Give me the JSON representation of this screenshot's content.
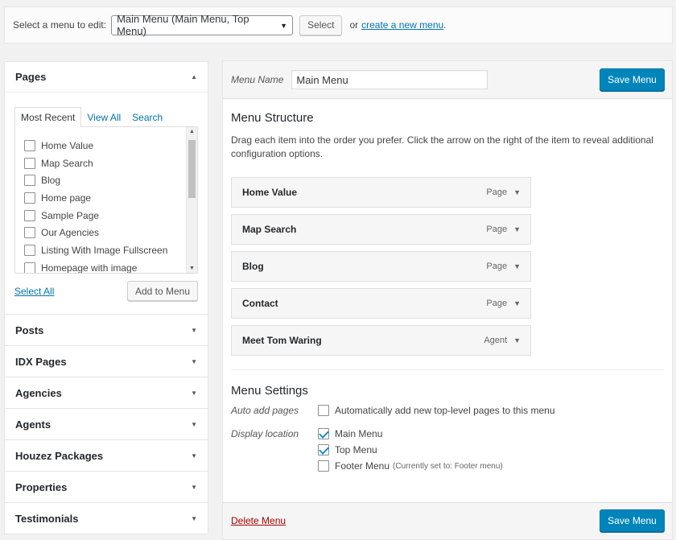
{
  "topbar": {
    "select_label": "Select a menu to edit:",
    "menu_select_value": "Main Menu (Main Menu, Top Menu)",
    "select_button": "Select",
    "or_text": "or",
    "create_link": "create a new menu",
    "period": "."
  },
  "sidebar": {
    "pages": {
      "title": "Pages",
      "tabs": [
        "Most Recent",
        "View All",
        "Search"
      ],
      "items": [
        "Home Value",
        "Map Search",
        "Blog",
        "Home page",
        "Sample Page",
        "Our Agencies",
        "Listing With Image Fullscreen",
        "Homepage with image"
      ],
      "select_all": "Select All",
      "add_button": "Add to Menu"
    },
    "sections": [
      "Posts",
      "IDX Pages",
      "Agencies",
      "Agents",
      "Houzez Packages",
      "Properties",
      "Testimonials"
    ]
  },
  "main": {
    "name_label": "Menu Name",
    "name_value": "Main Menu",
    "save_label": "Save Menu",
    "structure_title": "Menu Structure",
    "structure_desc": "Drag each item into the order you prefer. Click the arrow on the right of the item to reveal additional configuration options.",
    "items": [
      {
        "title": "Home Value",
        "type": "Page"
      },
      {
        "title": "Map Search",
        "type": "Page"
      },
      {
        "title": "Blog",
        "type": "Page"
      },
      {
        "title": "Contact",
        "type": "Page"
      },
      {
        "title": "Meet Tom Waring",
        "type": "Agent"
      }
    ],
    "settings_title": "Menu Settings",
    "auto_add_label": "Auto add pages",
    "auto_add_option": "Automatically add new top-level pages to this menu",
    "display_label": "Display location",
    "locations": [
      {
        "label": "Main Menu",
        "note": "",
        "checked": true
      },
      {
        "label": "Top Menu",
        "note": "",
        "checked": true
      },
      {
        "label": "Footer Menu",
        "note": "(Currently set to: Footer menu)",
        "checked": false
      }
    ],
    "delete_label": "Delete Menu"
  },
  "colors": {
    "primary": "#0085ba",
    "link": "#0073aa",
    "delete": "#aa0000"
  }
}
